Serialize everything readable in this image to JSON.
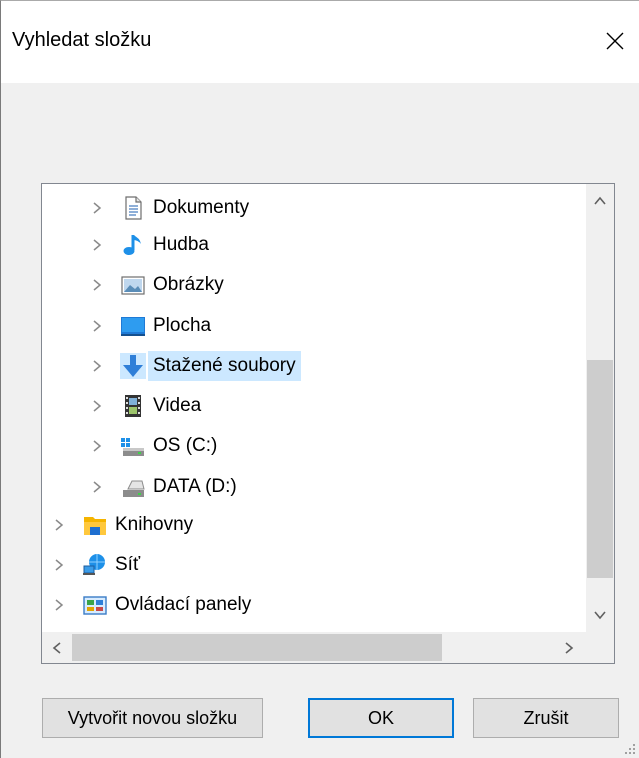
{
  "dialog": {
    "title": "Vyhledat složku",
    "close_icon": "close-icon"
  },
  "tree": {
    "items": [
      {
        "label": "Dokumenty",
        "icon": "documents-icon",
        "level": 1,
        "selected": false
      },
      {
        "label": "Hudba",
        "icon": "music-note-icon",
        "level": 1,
        "selected": false
      },
      {
        "label": "Obrázky",
        "icon": "pictures-icon",
        "level": 1,
        "selected": false
      },
      {
        "label": "Plocha",
        "icon": "desktop-icon",
        "level": 1,
        "selected": false
      },
      {
        "label": "Stažené soubory",
        "icon": "download-arrow-icon",
        "level": 1,
        "selected": true
      },
      {
        "label": "Videa",
        "icon": "video-film-icon",
        "level": 1,
        "selected": false
      },
      {
        "label": "OS (C:)",
        "icon": "system-drive-icon",
        "level": 1,
        "selected": false
      },
      {
        "label": "DATA (D:)",
        "icon": "drive-icon",
        "level": 1,
        "selected": false
      },
      {
        "label": "Knihovny",
        "icon": "libraries-icon",
        "level": 0,
        "selected": false
      },
      {
        "label": "Síť",
        "icon": "network-icon",
        "level": 0,
        "selected": false
      },
      {
        "label": "Ovládací panely",
        "icon": "control-panel-icon",
        "level": 0,
        "selected": false
      }
    ],
    "selection_color": "#cce8ff"
  },
  "buttons": {
    "new_folder": "Vytvořit novou složku",
    "ok": "OK",
    "cancel": "Zrušit"
  },
  "colors": {
    "dialog_background": "#f0f0f0",
    "default_button_border": "#0078d7",
    "download_icon": "#2f7fd8"
  }
}
